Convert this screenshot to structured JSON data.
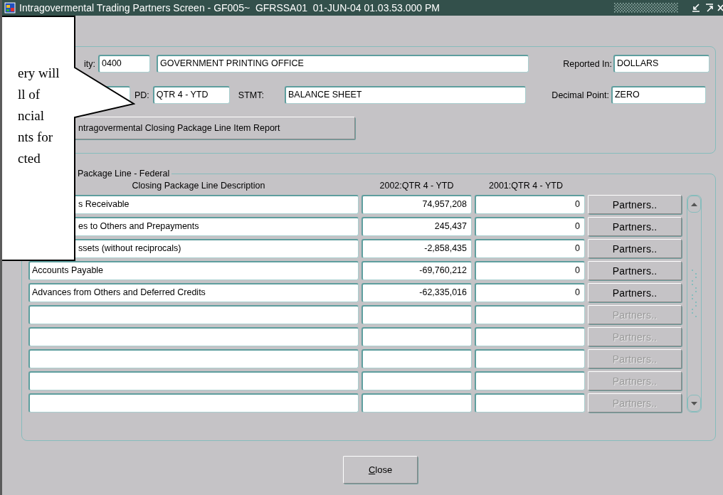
{
  "window": {
    "title": "Intragovermental Trading Partners Screen - GF005~  GFRSSA01  01-JUN-04 01.03.53.000 PM"
  },
  "header": {
    "entity_label": "ity:",
    "entity_code": "0400",
    "entity_name": "GOVERNMENT PRINTING OFFICE",
    "reported_in_label": "Reported In:",
    "reported_in": "DOLLARS",
    "pd_label": "PD:",
    "pd": "QTR 4 - YTD",
    "stmt_label": "STMT:",
    "stmt": "BALANCE SHEET",
    "decimal_label": "Decimal Point:",
    "decimal": "ZERO",
    "report_button": "ntragovermental Closing Package Line Item Report"
  },
  "lines": {
    "title": "Package Line - Federal",
    "columns": [
      "Closing Package Line Description",
      "2002:QTR 4 - YTD",
      "2001:QTR 4 - YTD"
    ],
    "rows": [
      {
        "description": "s Receivable",
        "current": "74,957,208",
        "prior": "0",
        "partners": "Partners..",
        "disabled": false
      },
      {
        "description": "es to Others and Prepayments",
        "current": "245,437",
        "prior": "0",
        "partners": "Partners..",
        "disabled": false
      },
      {
        "description": "ssets (without reciprocals)",
        "current": "-2,858,435",
        "prior": "0",
        "partners": "Partners..",
        "disabled": false
      },
      {
        "description": "Accounts Payable",
        "current": "-69,760,212",
        "prior": "0",
        "partners": "Partners..",
        "disabled": false
      },
      {
        "description": "Advances from Others and Deferred Credits",
        "current": "-62,335,016",
        "prior": "0",
        "partners": "Partners..",
        "disabled": false
      },
      {
        "partners": "Partners..",
        "disabled": true
      },
      {
        "partners": "Partners..",
        "disabled": true
      },
      {
        "partners": "Partners..",
        "disabled": true
      },
      {
        "partners": "Partners..",
        "disabled": true
      },
      {
        "partners": "Partners..",
        "disabled": true
      }
    ]
  },
  "close_button": "Close",
  "callout": {
    "lines": [
      "ery will",
      "ll of",
      "ncial",
      "nts for",
      "cted"
    ]
  }
}
